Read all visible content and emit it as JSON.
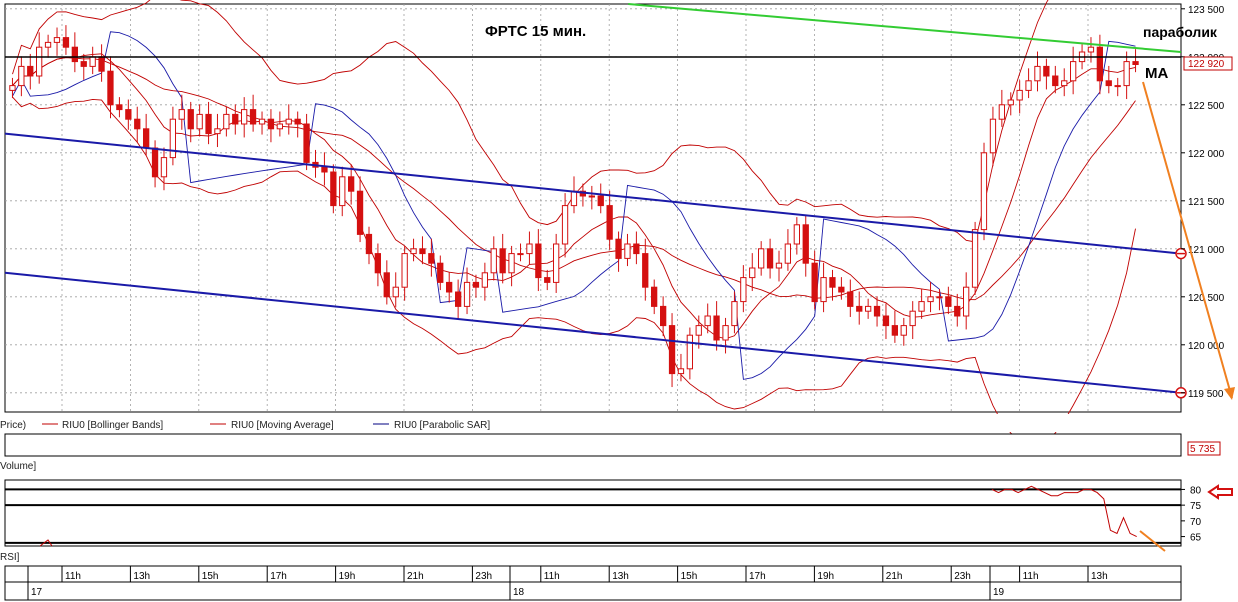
{
  "chart_data": {
    "type": "candlestick",
    "title": "ФРТС   15 мин.",
    "annotations": {
      "parabolic": "параболик",
      "ma": "MA"
    },
    "price_axis": {
      "ticks": [
        "123 500",
        "123 000",
        "122 500",
        "122 000",
        "121 500",
        "121 000",
        "120 500",
        "120 000",
        "119 500"
      ],
      "tick_values": [
        123500,
        123000,
        122500,
        122000,
        121500,
        121000,
        120500,
        120000,
        119500
      ],
      "ylim": [
        119300,
        123550
      ],
      "current_price": 122920,
      "current_price_label": "122 920"
    },
    "legend": [
      {
        "name": "Price",
        "label": "Price)"
      },
      {
        "name": "Bollinger Bands",
        "label": "RIU0 [Bollinger Bands]",
        "color": "#c00000"
      },
      {
        "name": "Moving Average",
        "label": "RIU0 [Moving Average]",
        "color": "#c00000"
      },
      {
        "name": "Parabolic SAR",
        "label": "RIU0 [Parabolic SAR]",
        "color": "#000080"
      }
    ],
    "volume_panel": {
      "label": "Volume]",
      "value_label": "5 735"
    },
    "rsi_panel": {
      "label": "RSI]",
      "ticks": [
        "80",
        "75",
        "70",
        "65"
      ],
      "tick_values": [
        80,
        75,
        70,
        65
      ],
      "ylim": [
        62,
        83
      ],
      "levels": [
        80,
        75,
        63
      ],
      "values": [
        70,
        70,
        71,
        69,
        70,
        71,
        70,
        69,
        70,
        70,
        71,
        70,
        69,
        70,
        71,
        70,
        70,
        69,
        70,
        71,
        70,
        70,
        69,
        70,
        71,
        70,
        69,
        70,
        70,
        71,
        70,
        69,
        70,
        71,
        70,
        70,
        69,
        70,
        70,
        71,
        70,
        69,
        70,
        70,
        71,
        70,
        69,
        70,
        70,
        71,
        70,
        70,
        69,
        70,
        71,
        70,
        69,
        70,
        70,
        71,
        70,
        69,
        70,
        71,
        70,
        70,
        69,
        70,
        70,
        71,
        70,
        69,
        70,
        70,
        71,
        70,
        69,
        70,
        70,
        71,
        70,
        69,
        70,
        71,
        70,
        70,
        69,
        70,
        70,
        71,
        70,
        69,
        70,
        70,
        71,
        70,
        69,
        70,
        70,
        71,
        70,
        70,
        69,
        70,
        71,
        70,
        69,
        70,
        70,
        71,
        70,
        69,
        70,
        70,
        71,
        70,
        69,
        70,
        70,
        71,
        70,
        69,
        70,
        70,
        71,
        70,
        69,
        70,
        70,
        71,
        70,
        70,
        69,
        70,
        71,
        70,
        69,
        70,
        70,
        71,
        70,
        69,
        70,
        70,
        71,
        70,
        69,
        70,
        70,
        80,
        79,
        80,
        80,
        79,
        80,
        81,
        80,
        79,
        78,
        78,
        79,
        79,
        79,
        80,
        80,
        79,
        77,
        67,
        66,
        71,
        66,
        65
      ]
    },
    "time_axis": {
      "hours": [
        "11h",
        "13h",
        "15h",
        "17h",
        "19h",
        "21h",
        "23h",
        "11h",
        "13h",
        "15h",
        "17h",
        "19h",
        "21h",
        "23h",
        "11h",
        "13h"
      ],
      "days": [
        "17",
        "18",
        "19"
      ]
    },
    "candles": {
      "open": [
        122650,
        122700,
        122900,
        122800,
        123100,
        123150,
        123200,
        123100,
        122950,
        122900,
        123000,
        122850,
        122500,
        122450,
        122350,
        122250,
        122050,
        121750,
        121950,
        122350,
        122450,
        122250,
        122400,
        122200,
        122250,
        122400,
        122300,
        122450,
        122300,
        122350,
        122250,
        122300,
        122350,
        122300,
        121900,
        121850,
        121800,
        121450,
        121750,
        121600,
        121150,
        120950,
        120750,
        120500,
        120600,
        120950,
        121000,
        120950,
        120850,
        120650,
        120550,
        120400,
        120650,
        120600,
        120750,
        121000,
        120750,
        120950,
        120950,
        121050,
        120700,
        120650,
        121050,
        121450,
        121600,
        121550,
        121550,
        121450,
        121100,
        120900,
        121050,
        120950,
        120600,
        120400,
        120200,
        119700,
        119750,
        120100,
        120200,
        120300,
        120050,
        120200,
        120450,
        120700,
        120800,
        121000,
        120800,
        120850,
        121050,
        121250,
        120850,
        120450,
        120700,
        120600,
        120550,
        120400,
        120350,
        120400,
        120300,
        120200,
        120100,
        120200,
        120350,
        120450,
        120500,
        120500,
        120400,
        120300,
        120600,
        121200,
        122000,
        122350,
        122500,
        122550,
        122650,
        122750,
        122900,
        122800,
        122700,
        122750,
        122950,
        123050,
        123100,
        122750,
        122700,
        122700,
        122950
      ],
      "close": [
        122700,
        122900,
        122800,
        123100,
        123150,
        123200,
        123100,
        122950,
        122900,
        123000,
        122850,
        122500,
        122450,
        122350,
        122250,
        122050,
        121750,
        121950,
        122350,
        122450,
        122250,
        122400,
        122200,
        122250,
        122400,
        122300,
        122450,
        122300,
        122350,
        122250,
        122300,
        122350,
        122300,
        121900,
        121850,
        121800,
        121450,
        121750,
        121600,
        121150,
        120950,
        120750,
        120500,
        120600,
        120950,
        121000,
        120950,
        120850,
        120650,
        120550,
        120400,
        120650,
        120600,
        120750,
        121000,
        120750,
        120950,
        120950,
        121050,
        120700,
        120650,
        121050,
        121450,
        121600,
        121550,
        121550,
        121450,
        121100,
        120900,
        121050,
        120950,
        120600,
        120400,
        120200,
        119700,
        119750,
        120100,
        120200,
        120300,
        120050,
        120200,
        120450,
        120700,
        120800,
        121000,
        120800,
        120850,
        121050,
        121250,
        120850,
        120450,
        120700,
        120600,
        120550,
        120400,
        120350,
        120400,
        120300,
        120200,
        120100,
        120200,
        120350,
        120450,
        120500,
        120500,
        120400,
        120300,
        120600,
        121200,
        122000,
        122350,
        122500,
        122550,
        122650,
        122750,
        122900,
        122800,
        122700,
        122750,
        122950,
        123050,
        123100,
        122750,
        122700,
        122700,
        122950,
        122920
      ]
    },
    "trend_lines": [
      {
        "color": "#1a1aa8",
        "from": [
          0,
          122200
        ],
        "to": [
          1,
          120950
        ]
      },
      {
        "color": "#1a1aa8",
        "from": [
          0,
          120750
        ],
        "to": [
          1,
          119500
        ]
      },
      {
        "color": "#33cc33",
        "from": [
          0.53,
          123550
        ],
        "to": [
          1,
          123050
        ]
      }
    ],
    "forecast_arrow_color": "#f08020"
  },
  "colors": {
    "bullish": "#ffffff",
    "bearish": "#d41010",
    "grid": "#9a9a9a",
    "axis_bg": "#ffffff"
  }
}
